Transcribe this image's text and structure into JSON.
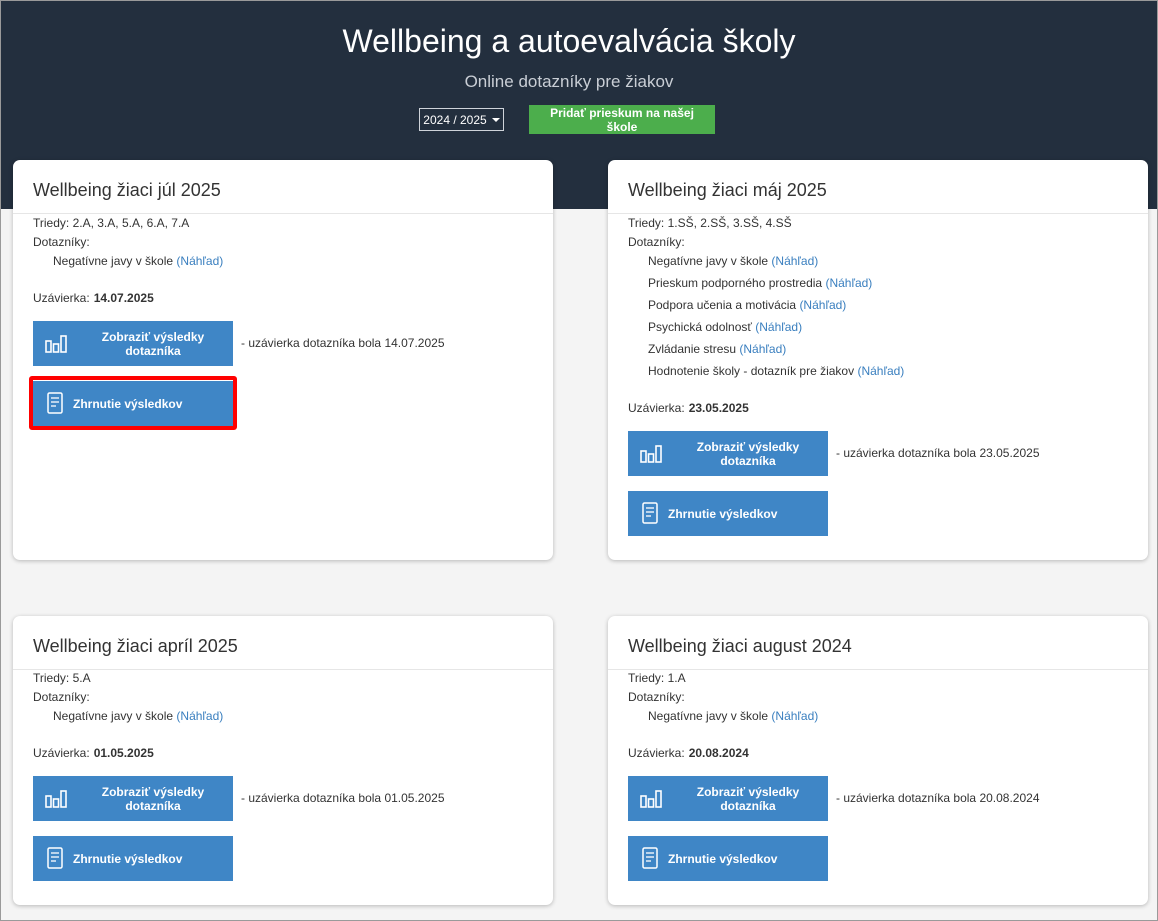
{
  "header": {
    "title": "Wellbeing a autoevalvácia školy",
    "subtitle": "Online dotazníky pre žiakov",
    "year_select": "2024 / 2025",
    "add_button": "Pridať prieskum na našej škole",
    "bg_color": "#232f3e",
    "add_button_color": "#4cae4c"
  },
  "labels": {
    "classes": "Triedy:",
    "questionnaires": "Dotazníky:",
    "preview": "(Náhľad)",
    "closing": "Uzávierka:",
    "show_results_line1": "Zobraziť výsledky",
    "show_results_line2": "dotazníka",
    "summary": "Zhrnutie výsledkov",
    "note_prefix": "- uzávierka dotazníka bola"
  },
  "colors": {
    "button": "#3f86c6",
    "link": "#3a7fbf",
    "highlight": "#ff0000"
  },
  "cards": [
    {
      "title": "Wellbeing žiaci júl 2025",
      "classes": "2.A, 3.A, 5.A, 6.A, 7.A",
      "questionnaires": [
        "Negatívne javy v škole"
      ],
      "closing_date": "14.07.2025",
      "note_date": "14.07.2025",
      "summary_highlighted": true
    },
    {
      "title": "Wellbeing žiaci máj 2025",
      "classes": "1.SŠ, 2.SŠ, 3.SŠ, 4.SŠ",
      "questionnaires": [
        "Negatívne javy v škole",
        "Prieskum podporného prostredia",
        "Podpora učenia a motivácia",
        "Psychická odolnosť",
        "Zvládanie stresu",
        "Hodnotenie školy - dotazník pre žiakov"
      ],
      "closing_date": "23.05.2025",
      "note_date": "23.05.2025",
      "summary_highlighted": false
    },
    {
      "title": "Wellbeing žiaci apríl 2025",
      "classes": "5.A",
      "questionnaires": [
        "Negatívne javy v škole"
      ],
      "closing_date": "01.05.2025",
      "note_date": "01.05.2025",
      "summary_highlighted": false
    },
    {
      "title": "Wellbeing žiaci august 2024",
      "classes": "1.A",
      "questionnaires": [
        "Negatívne javy v škole"
      ],
      "closing_date": "20.08.2024",
      "note_date": "20.08.2024",
      "summary_highlighted": false
    }
  ]
}
